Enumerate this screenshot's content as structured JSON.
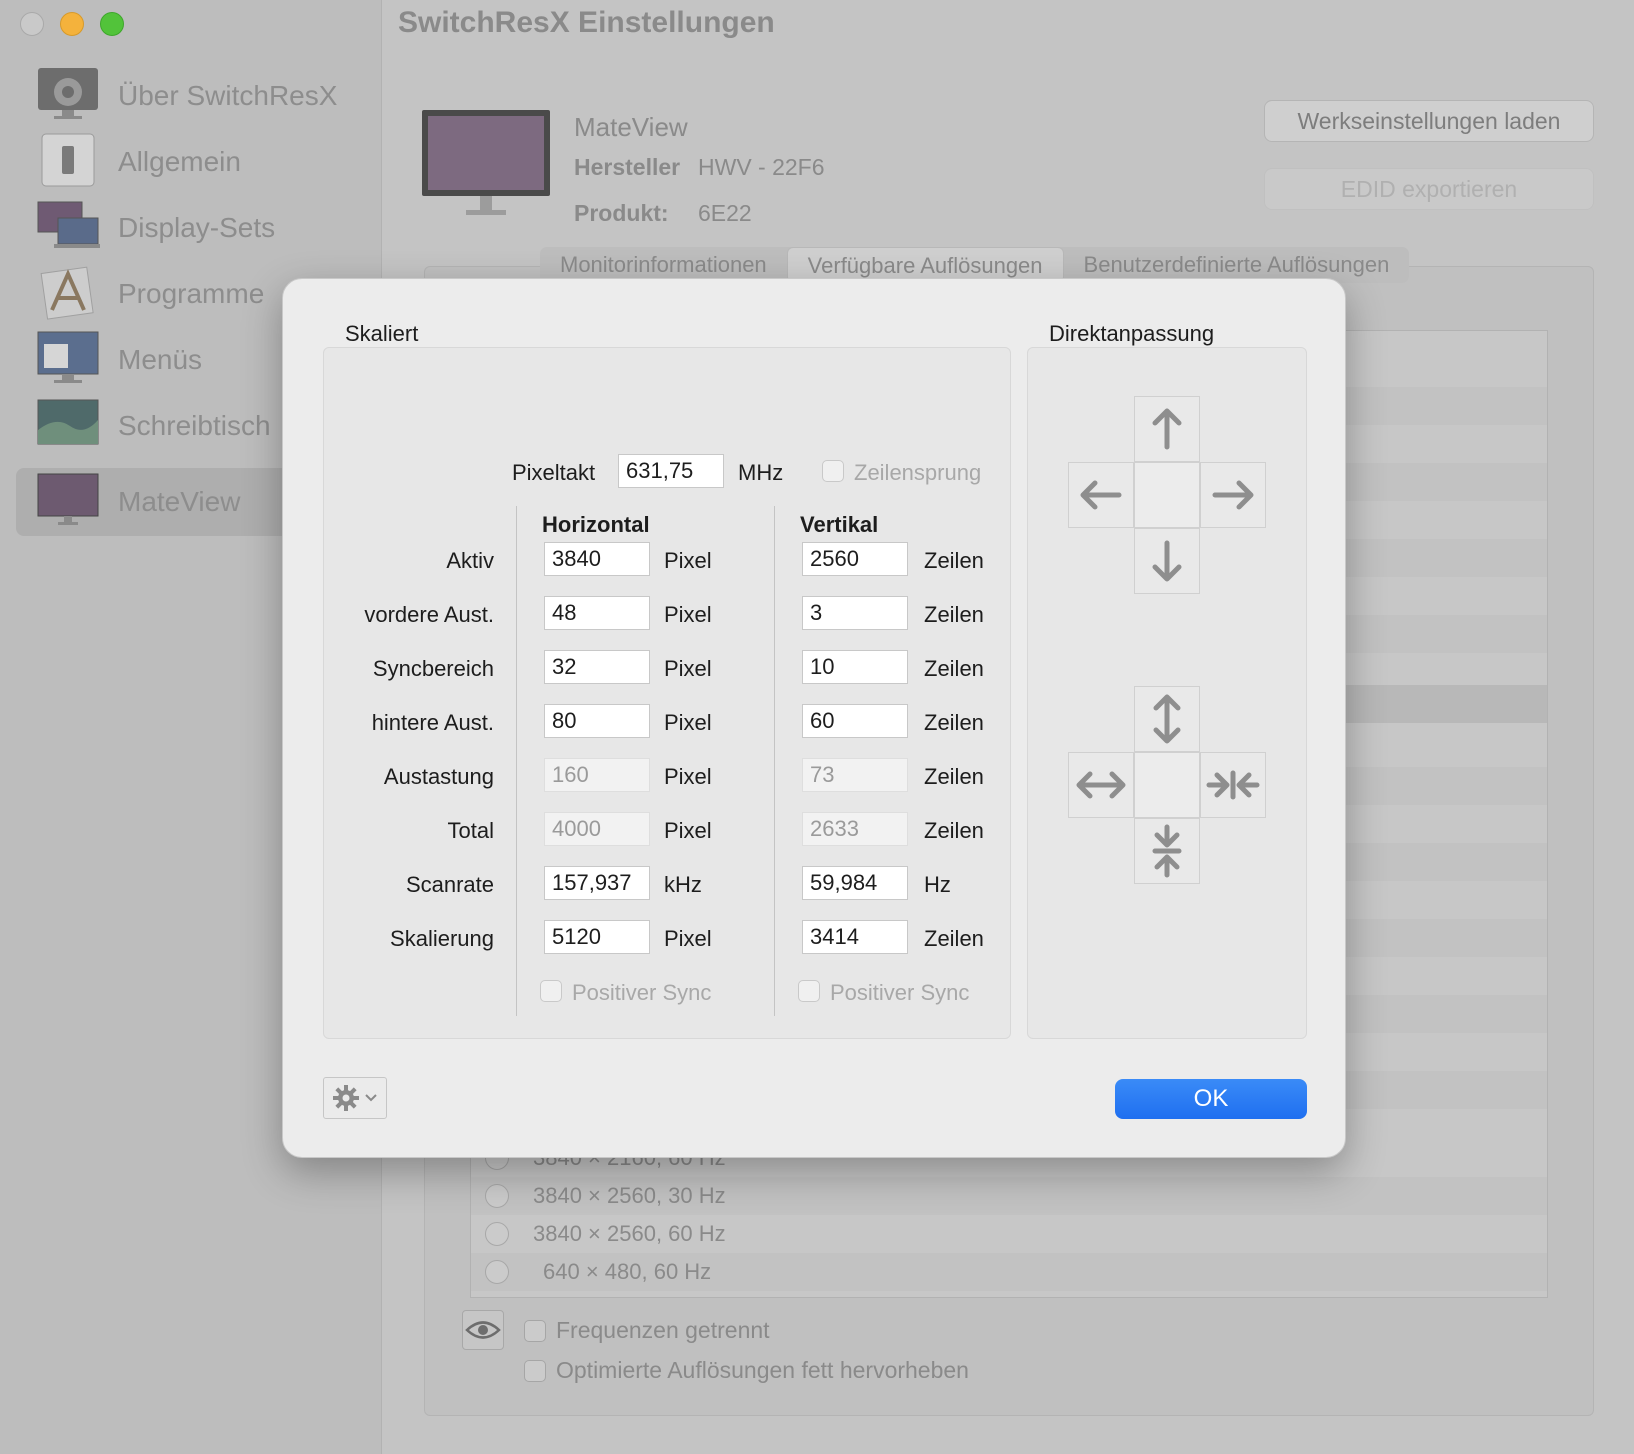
{
  "window": {
    "title": "SwitchResX Einstellungen",
    "traffic_lights": [
      "close",
      "minimize",
      "zoom"
    ]
  },
  "sidebar": {
    "items": [
      {
        "label": "Über SwitchResX",
        "icon": "gear-icon"
      },
      {
        "label": "Allgemein",
        "icon": "switch-icon"
      },
      {
        "label": "Display-Sets",
        "icon": "displays-icon"
      },
      {
        "label": "Programme",
        "icon": "applications-icon"
      },
      {
        "label": "Menüs",
        "icon": "menu-icon"
      },
      {
        "label": "Schreibtisch",
        "icon": "desktop-icon"
      },
      {
        "label": "MateView",
        "icon": "monitor-icon",
        "selected": true
      }
    ]
  },
  "monitor": {
    "name": "MateView",
    "manufacturer_label": "Hersteller",
    "manufacturer_value": "HWV - 22F6",
    "product_label": "Produkt:",
    "product_value": "6E22"
  },
  "buttons": {
    "factory": "Werkseinstellungen laden",
    "edid": "EDID exportieren"
  },
  "tabs": [
    {
      "label": "Monitorinformationen"
    },
    {
      "label": "Verfügbare Auflösungen",
      "selected": true
    },
    {
      "label": "Benutzerdefinierte Auflösungen"
    }
  ],
  "resolution_list": {
    "partial_row": "3840 × 2160, 60 Hz",
    "rows": [
      "3840 × 2560, 30 Hz",
      "3840 × 2560, 60 Hz",
      " 640 × 480, 60 Hz"
    ]
  },
  "options": {
    "separate_frequencies": "Frequenzen getrennt",
    "bold_optimized": "Optimierte Auflösungen fett hervorheben"
  },
  "dialog": {
    "scaled_title": "Skaliert",
    "direct_title": "Direktanpassung",
    "pixelclock": {
      "label": "Pixeltakt",
      "value": "631,75",
      "unit": "MHz"
    },
    "interlace_label": "Zeilensprung",
    "horizontal_header": "Horizontal",
    "vertical_header": "Vertikal",
    "rows": [
      {
        "label": "Aktiv",
        "h": "3840",
        "h_unit": "Pixel",
        "v": "2560",
        "v_unit": "Zeilen",
        "readonly": false
      },
      {
        "label": "vordere Aust.",
        "h": "48",
        "h_unit": "Pixel",
        "v": "3",
        "v_unit": "Zeilen",
        "readonly": false
      },
      {
        "label": "Syncbereich",
        "h": "32",
        "h_unit": "Pixel",
        "v": "10",
        "v_unit": "Zeilen",
        "readonly": false
      },
      {
        "label": "hintere Aust.",
        "h": "80",
        "h_unit": "Pixel",
        "v": "60",
        "v_unit": "Zeilen",
        "readonly": false
      },
      {
        "label": "Austastung",
        "h": "160",
        "h_unit": "Pixel",
        "v": "73",
        "v_unit": "Zeilen",
        "readonly": true
      },
      {
        "label": "Total",
        "h": "4000",
        "h_unit": "Pixel",
        "v": "2633",
        "v_unit": "Zeilen",
        "readonly": true
      },
      {
        "label": "Scanrate",
        "h": "157,937",
        "h_unit": "kHz",
        "v": "59,984",
        "v_unit": "Hz",
        "readonly": false
      },
      {
        "label": "Skalierung",
        "h": "5120",
        "h_unit": "Pixel",
        "v": "3414",
        "v_unit": "Zeilen",
        "readonly": false
      }
    ],
    "positive_sync_h": "Positiver Sync",
    "positive_sync_v": "Positiver Sync",
    "ok_label": "OK",
    "accent_color": "#1f6ff0"
  }
}
